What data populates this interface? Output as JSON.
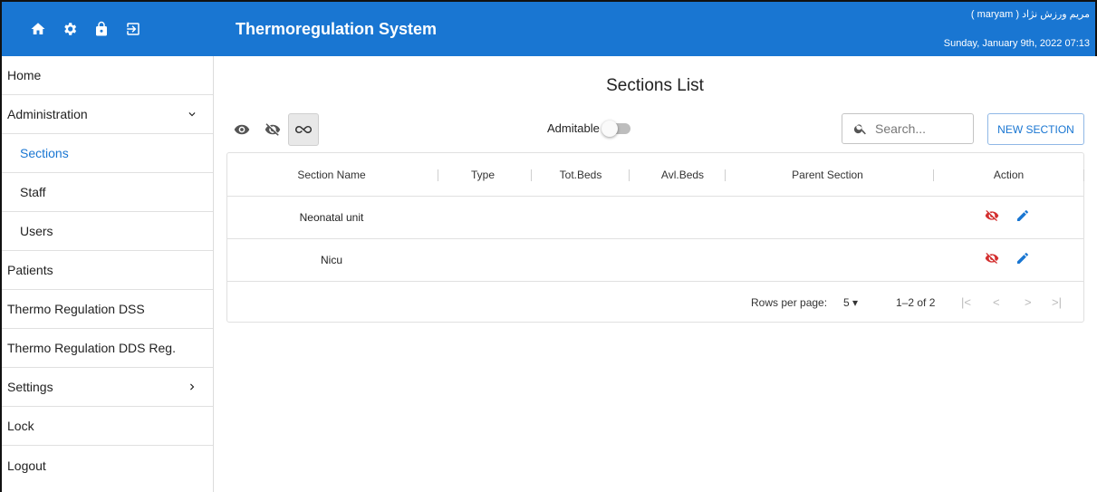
{
  "app": {
    "title": "Thermoregulation System",
    "user": "مریم ورزش نژاد ( maryam )",
    "datetime": "Sunday, January 9th, 2022 07:13",
    "accent": "#1976d2"
  },
  "top_icons": [
    "home-icon",
    "gear-icon",
    "lock-icon",
    "logout-icon"
  ],
  "sidebar": {
    "home": "Home",
    "administration": "Administration",
    "sections": "Sections",
    "staff": "Staff",
    "users": "Users",
    "patients": "Patients",
    "thermo_dss": "Thermo Regulation DSS",
    "thermo_dds_reg": "Thermo Regulation DDS Reg.",
    "settings": "Settings",
    "lock": "Lock",
    "logout": "Logout"
  },
  "main": {
    "title": "Sections List",
    "admitable_label": "Admitable",
    "admitable_on": false,
    "search_placeholder": "Search...",
    "new_button": "NEW SECTION",
    "view_toggles": [
      "eye-icon",
      "eye-off-icon",
      "infinity-icon"
    ],
    "selected_toggle": "infinity-icon"
  },
  "table": {
    "headers": {
      "name": "Section Name",
      "type": "Type",
      "tot_beds": "Tot.Beds",
      "avl_beds": "Avl.Beds",
      "parent": "Parent Section",
      "action": "Action"
    },
    "rows": [
      {
        "name": "Neonatal unit"
      },
      {
        "name": "Nicu"
      }
    ]
  },
  "pagination": {
    "rows_per_page_label": "Rows per page:",
    "rows_per_page": "5",
    "range": "1–2 of 2"
  }
}
